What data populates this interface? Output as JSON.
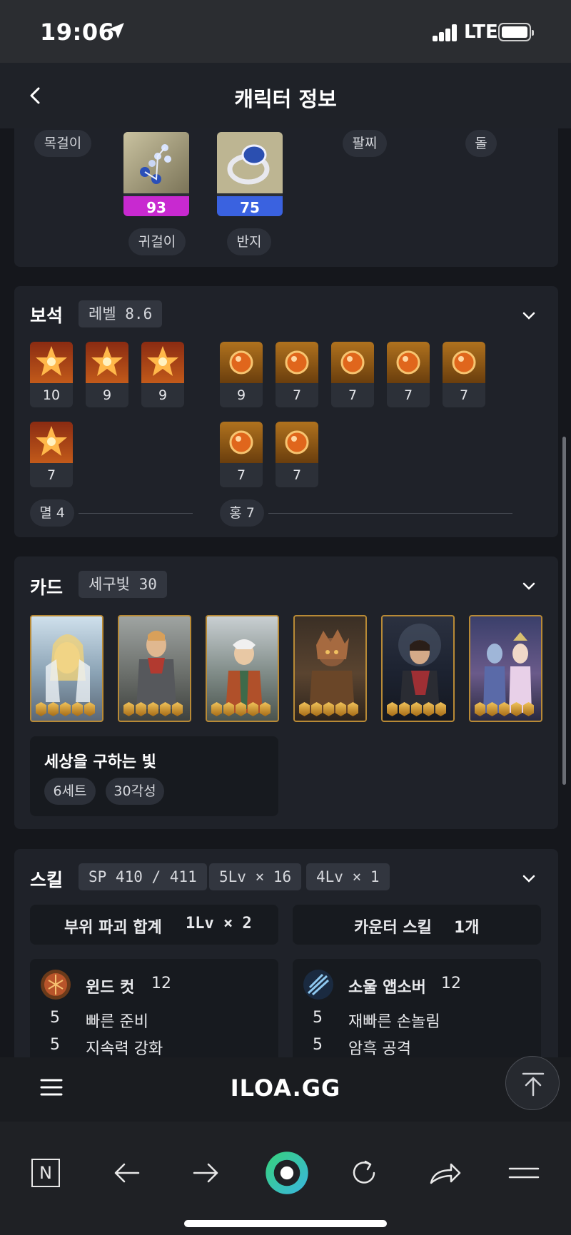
{
  "status": {
    "time": "19:06",
    "network": "LTE"
  },
  "header": {
    "title": "캐릭터 정보"
  },
  "accessories": {
    "slots": {
      "necklace": "목걸이",
      "bracelet": "팔찌",
      "stone": "돌",
      "earring": "귀걸이",
      "ring": "반지"
    },
    "earring_quality": "93",
    "ring_quality": "75",
    "earring_color": "#c829d0",
    "ring_color": "#3a62e0"
  },
  "gems": {
    "title": "보석",
    "level_tag": "레벨 8.6",
    "left": [
      "10",
      "9",
      "9",
      "7"
    ],
    "right": [
      "9",
      "7",
      "7",
      "7",
      "7",
      "7",
      "7"
    ],
    "left_summary": "멸 4",
    "right_summary": "홍 7"
  },
  "cards": {
    "title": "카드",
    "tag": "세구빛 30",
    "set_name": "세상을 구하는 빛",
    "set_count": "6세트",
    "awakening": "30각성"
  },
  "skills": {
    "title": "스킬",
    "sp": "SP 410 / 411",
    "lv5": "5Lv × 16",
    "lv4": "4Lv × 1",
    "destruction_label": "부위 파괴 합계",
    "destruction_value": "1Lv × 2",
    "counter_label": "카운터 스킬",
    "counter_value": "1개",
    "left": {
      "name": "윈드 컷",
      "level": "12",
      "tripods": [
        {
          "lv": "5",
          "name": "빠른 준비"
        },
        {
          "lv": "5",
          "name": "지속력 강화"
        }
      ]
    },
    "right": {
      "name": "소울 앱소버",
      "level": "12",
      "tripods": [
        {
          "lv": "5",
          "name": "재빠른 손놀림"
        },
        {
          "lv": "5",
          "name": "암흑 공격"
        }
      ]
    }
  },
  "footer": {
    "logo": "ILOA.GG"
  },
  "browser": {
    "n_label": "N"
  }
}
